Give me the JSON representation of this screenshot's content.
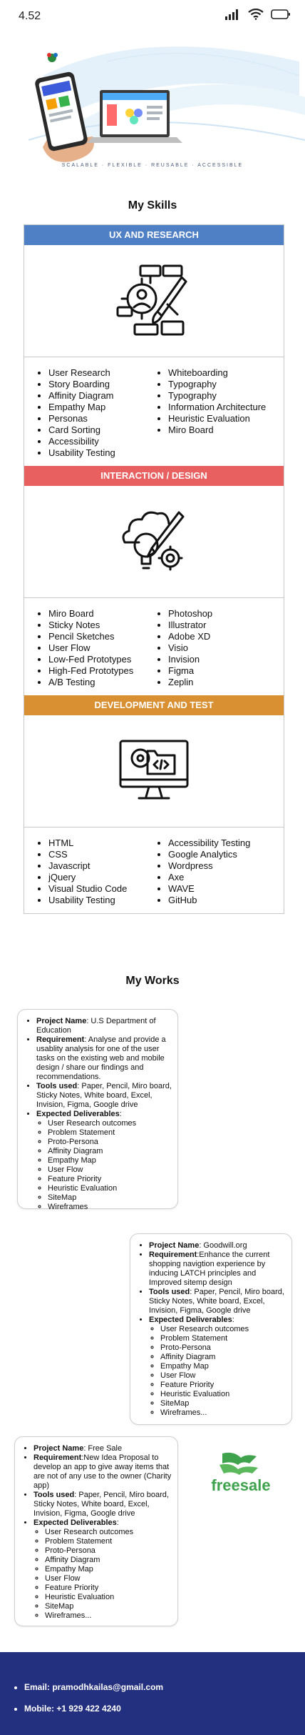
{
  "status_bar": {
    "time": "4.52"
  },
  "hero": {
    "caption": "SCALABLE · FLEXIBLE · REUSABLE · ACCESSIBLE"
  },
  "skills_title": "My Skills",
  "skills": [
    {
      "title": "UX AND RESEARCH",
      "color": "#4f7fc4",
      "icon": "ux-research-icon",
      "col1": [
        "User Research",
        "Story Boarding",
        "Affinity Diagram",
        "Empathy Map",
        "Personas",
        "Card Sorting",
        "Accessibility",
        "Usability Testing"
      ],
      "col2": [
        "Whiteboarding",
        "Typography",
        "Typography",
        "Information Architecture",
        "Heuristic Evaluation",
        "Miro Board"
      ]
    },
    {
      "title": "INTERACTION / DESIGN",
      "color": "#e86060",
      "icon": "interaction-design-icon",
      "col1": [
        "Miro Board",
        "Sticky Notes",
        "Pencil Sketches",
        "User Flow",
        "Low-Fed Prototypes",
        "High-Fed Prototypes",
        "A/B Testing"
      ],
      "col2": [
        "Photoshop",
        "Illustrator",
        "Adobe XD",
        "Visio",
        "Invision",
        "Figma",
        "Zeplin"
      ]
    },
    {
      "title": "DEVELOPMENT AND TEST",
      "color": "#d99032",
      "icon": "development-test-icon",
      "col1": [
        "HTML",
        "CSS",
        "Javascript",
        "jQuery",
        "Visual Studio Code",
        "Usability Testing"
      ],
      "col2": [
        "Accessibility Testing",
        "Google Analytics",
        "Wordpress",
        "Axe",
        "WAVE",
        "GitHub"
      ]
    }
  ],
  "works_title": "My Works",
  "works": [
    {
      "project_label": "Project Name",
      "project": ": U.S Department of Education",
      "requirement_label": "Requirement",
      "requirement": ": Analyse and provide a usablity analysis for one of the user tasks on the existing web and mobile design / share our findings and recommendations.",
      "tools_label": "Tools used",
      "tools": ": Paper, Pencil, Miro board, Sticky Notes, White board, Excel, Invision, Figma, Google drive",
      "deliverables_label": "Expected Deliverables",
      "deliverables": [
        "User Research outcomes",
        "Problem Statement",
        "Proto-Persona",
        "Affinity Diagram",
        "Empathy Map",
        "User Flow",
        "Feature Priority",
        "Heuristic Evaluation",
        "SiteMap",
        "Wireframes"
      ]
    },
    {
      "project_label": "Project Name",
      "project": ": Goodwill.org",
      "requirement_label": "Requirement",
      "requirement": ":Enhance the current shopping navigtion experience by inducing LATCH principles and Improved sitemp design",
      "tools_label": "Tools used",
      "tools": ": Paper, Pencil, Miro board, Sticky Notes, White board, Excel, Invision, Figma, Google drive",
      "deliverables_label": "Expected Deliverables",
      "deliverables": [
        "User Research outcomes",
        "Problem Statement",
        "Proto-Persona",
        "Affinity Diagram",
        "Empathy Map",
        "User Flow",
        "Feature Priority",
        "Heuristic Evaluation",
        "SiteMap",
        "Wireframes..."
      ]
    },
    {
      "project_label": "Project Name",
      "project": ": Free Sale",
      "requirement_label": "Requirement",
      "requirement": ":New Idea Proposal to develop an app to give away items that are not of any use to the owner (Charity app)",
      "tools_label": "Tools used",
      "tools": ": Paper, Pencil, Miro board, Sticky Notes, White board, Excel, Invision, Figma, Google drive",
      "deliverables_label": "Expected Deliverables",
      "deliverables": [
        "User Research outcomes",
        "Problem Statement",
        "Proto-Persona",
        "Affinity Diagram",
        "Empathy Map",
        "User Flow",
        "Feature Priority",
        "Heuristic Evaluation",
        "SiteMap",
        "Wireframes..."
      ],
      "logo": "freesale"
    }
  ],
  "footer": {
    "email": "Email: pramodhkailas@gmail.com",
    "mobile": "Mobile: +1 929 422 4240",
    "background": "#232f7f"
  }
}
